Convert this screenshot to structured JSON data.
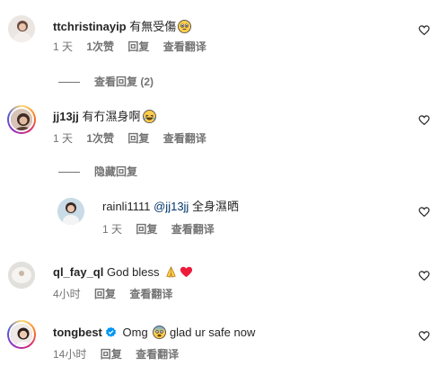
{
  "comments": [
    {
      "username": "ttchristinayip",
      "text": "有無受傷",
      "emoji": "pleading-face",
      "time": "1 天",
      "likes": "1次赞",
      "reply": "回复",
      "translate": "查看翻译",
      "view_replies": "查看回复 (2)"
    },
    {
      "username": "jj13jj",
      "text": "有冇濕身啊",
      "emoji": "laughing-face",
      "time": "1 天",
      "likes": "1次赞",
      "reply": "回复",
      "translate": "查看翻译",
      "hide_replies": "隐藏回复",
      "replies": [
        {
          "username": "rainli1111",
          "mention": "@jj13jj",
          "text": "全身濕晒",
          "time": "1 天",
          "reply": "回复",
          "translate": "查看翻译"
        }
      ]
    },
    {
      "username": "ql_fay_ql",
      "text": "God bless",
      "emoji": "folded-hands + red-heart",
      "time": "4小时",
      "reply": "回复",
      "translate": "查看翻译"
    },
    {
      "username": "tongbest",
      "verified": true,
      "text_before": "Omg",
      "emoji": "fearful-face",
      "text_after": "glad ur safe now",
      "time": "14小时",
      "reply": "回复",
      "translate": "查看翻译"
    }
  ],
  "icons": {
    "like": "heart-outline-icon",
    "verified": "verified-badge-icon"
  },
  "colors": {
    "text": "#262626",
    "secondary": "#737373",
    "mention": "#00376b",
    "verified": "#0095f6",
    "heart_emoji": "#ed1c3a"
  }
}
